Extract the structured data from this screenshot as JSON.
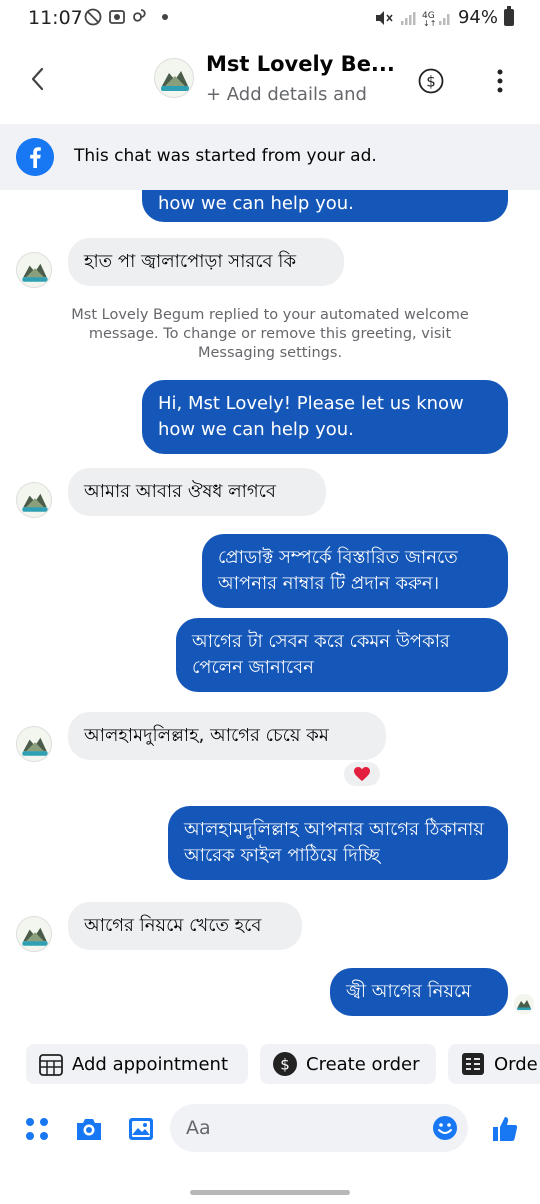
{
  "status_bar": {
    "time": "11:07",
    "battery": "94%"
  },
  "header": {
    "contact_name": "Mst Lovely Be...",
    "subtitle": "+ Add details and",
    "icons": [
      "back-arrow-icon",
      "dollar-icon",
      "more-vertical-icon"
    ]
  },
  "ad_banner": {
    "text": "This chat was started from your ad."
  },
  "messages": [
    {
      "side": "out",
      "text": "how we can help you."
    },
    {
      "side": "in",
      "text": "হাত পা জ্বালাপোড়া সারবে কি"
    },
    {
      "side": "system",
      "text": "Mst Lovely Begum replied to your automated welcome message. To change or remove this greeting, visit Messaging settings."
    },
    {
      "side": "out",
      "text": "Hi, Mst Lovely! Please let us know how we can help you."
    },
    {
      "side": "in",
      "text": "আমার আবার ঔষধ লাগবে"
    },
    {
      "side": "out",
      "text": "প্রোডাক্ট সম্পর্কে বিস্তারিত জানতে আপনার নাম্বার টি প্রদান করুন।"
    },
    {
      "side": "out",
      "text": "আগের টা সেবন করে কেমন উপকার পেলেন জানাবেন"
    },
    {
      "side": "in",
      "text": "আলহামদুলিল্লাহ, আগের চেয়ে কম",
      "reaction": "heart"
    },
    {
      "side": "out",
      "text": "আলহামদুলিল্লাহ আপনার আগের ঠিকানায় আরেক ফাইল পাঠিয়ে দিচ্ছি"
    },
    {
      "side": "in",
      "text": "আগের নিয়মে খেতে হবে"
    },
    {
      "side": "out",
      "text": "জ্বী আগের নিয়মে"
    }
  ],
  "quick_actions": [
    {
      "label": "Add appointment",
      "icon": "calendar-icon"
    },
    {
      "label": "Create order",
      "icon": "dollar-icon"
    },
    {
      "label": "Orde",
      "icon": "list-icon"
    }
  ],
  "composer": {
    "placeholder": "Aa"
  },
  "colors": {
    "outgoing_bubble": "#1557b8",
    "incoming_bubble": "#eeeff1",
    "accent": "#1877f2"
  }
}
